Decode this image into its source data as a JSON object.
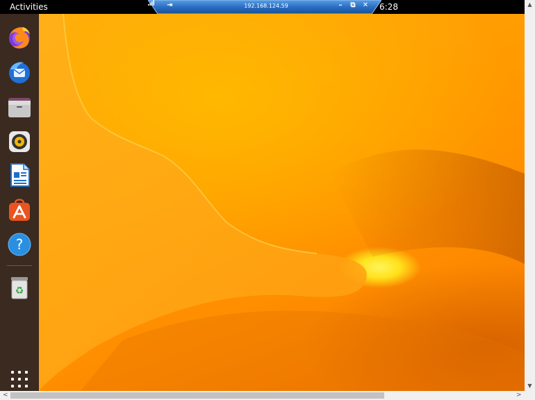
{
  "topbar": {
    "activities_label": "Activities",
    "clock": "6:28"
  },
  "remote_bar": {
    "host": "192.168.124.59",
    "pin_icon": "pin-icon",
    "signal_icon": "signal-icon",
    "minimize_label": "–",
    "restore_label": "⧉",
    "close_label": "✕"
  },
  "dock": {
    "items": [
      {
        "name": "firefox",
        "icon": "firefox-icon"
      },
      {
        "name": "thunderbird",
        "icon": "thunderbird-icon"
      },
      {
        "name": "files",
        "icon": "files-icon"
      },
      {
        "name": "rhythmbox",
        "icon": "rhythmbox-icon"
      },
      {
        "name": "libreoffice-writer",
        "icon": "writer-icon"
      },
      {
        "name": "ubuntu-software",
        "icon": "software-icon"
      },
      {
        "name": "help",
        "icon": "help-icon"
      },
      {
        "name": "trash",
        "icon": "trash-icon"
      }
    ],
    "show_apps_icon": "apps-grid-icon"
  },
  "scrollbars": {
    "up": "▲",
    "down": "▼",
    "left": "<",
    "right": ">"
  },
  "colors": {
    "topbar": "#000000",
    "dock": "#3b2a20",
    "wallpaper_primary": "#ff9a00",
    "remote_bar": "#2a6fc2"
  }
}
